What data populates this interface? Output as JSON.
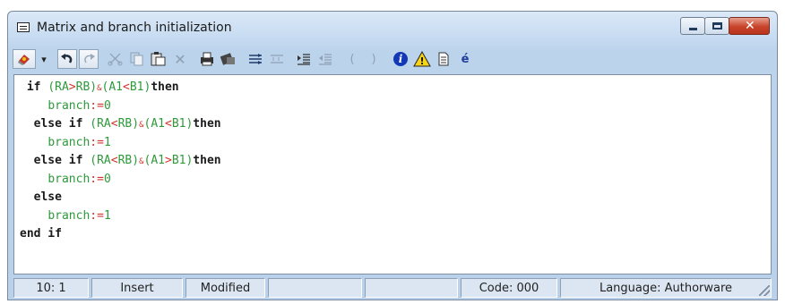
{
  "window": {
    "title": "Matrix and branch initialization",
    "controls": {
      "minimize_icon": "minimize-icon",
      "maximize_icon": "maximize-icon",
      "close_glyph": "✕"
    }
  },
  "toolbar": {
    "buttons": [
      {
        "icon": "eraser-icon",
        "label": ""
      },
      {
        "icon": "dropdown-arrow-icon",
        "label": "▾"
      },
      {
        "icon": "undo-icon",
        "label": ""
      },
      {
        "icon": "redo-icon",
        "label": ""
      },
      {
        "icon": "cut-icon",
        "label": ""
      },
      {
        "icon": "copy-icon",
        "label": ""
      },
      {
        "icon": "paste-icon",
        "label": ""
      },
      {
        "icon": "delete-icon",
        "label": "✕"
      },
      {
        "icon": "print-icon",
        "label": ""
      },
      {
        "icon": "find-icon",
        "label": ""
      },
      {
        "icon": "indent-icon",
        "label": ""
      },
      {
        "icon": "outdent-icon",
        "label": ""
      },
      {
        "icon": "block-indent-icon",
        "label": ""
      },
      {
        "icon": "block-outdent-icon",
        "label": ""
      },
      {
        "icon": "open-paren-icon",
        "label": "("
      },
      {
        "icon": "close-paren-icon",
        "label": ")"
      },
      {
        "icon": "info-icon",
        "label": "i"
      },
      {
        "icon": "warning-icon",
        "label": "!"
      },
      {
        "icon": "document-icon",
        "label": ""
      },
      {
        "icon": "accent-char-icon",
        "label": "é"
      }
    ]
  },
  "code_lines": [
    {
      "indent": " ",
      "tokens": [
        {
          "t": "kw",
          "v": "if"
        },
        {
          "t": "p",
          "v": " "
        },
        {
          "t": "g",
          "v": "(RA"
        },
        {
          "t": "r",
          "v": ">"
        },
        {
          "t": "g",
          "v": "RB)"
        },
        {
          "t": "r",
          "v": "&"
        },
        {
          "t": "g",
          "v": "(A1"
        },
        {
          "t": "r",
          "v": "<"
        },
        {
          "t": "g",
          "v": "B1)"
        },
        {
          "t": "kw",
          "v": "then"
        }
      ]
    },
    {
      "indent": "    ",
      "tokens": [
        {
          "t": "g",
          "v": "branch"
        },
        {
          "t": "r",
          "v": ":="
        },
        {
          "t": "g",
          "v": "0"
        }
      ]
    },
    {
      "indent": "  ",
      "tokens": [
        {
          "t": "kw",
          "v": "else if"
        },
        {
          "t": "p",
          "v": " "
        },
        {
          "t": "g",
          "v": "(RA"
        },
        {
          "t": "r",
          "v": "<"
        },
        {
          "t": "g",
          "v": "RB)"
        },
        {
          "t": "r",
          "v": "&"
        },
        {
          "t": "g",
          "v": "(A1"
        },
        {
          "t": "r",
          "v": "<"
        },
        {
          "t": "g",
          "v": "B1)"
        },
        {
          "t": "kw",
          "v": "then"
        }
      ]
    },
    {
      "indent": "    ",
      "tokens": [
        {
          "t": "g",
          "v": "branch"
        },
        {
          "t": "r",
          "v": ":="
        },
        {
          "t": "g",
          "v": "1"
        }
      ]
    },
    {
      "indent": "  ",
      "tokens": [
        {
          "t": "kw",
          "v": "else if"
        },
        {
          "t": "p",
          "v": " "
        },
        {
          "t": "g",
          "v": "(RA"
        },
        {
          "t": "r",
          "v": "<"
        },
        {
          "t": "g",
          "v": "RB)"
        },
        {
          "t": "r",
          "v": "&"
        },
        {
          "t": "g",
          "v": "(A1"
        },
        {
          "t": "r",
          "v": ">"
        },
        {
          "t": "g",
          "v": "B1)"
        },
        {
          "t": "kw",
          "v": "then"
        }
      ]
    },
    {
      "indent": "    ",
      "tokens": [
        {
          "t": "g",
          "v": "branch"
        },
        {
          "t": "r",
          "v": ":="
        },
        {
          "t": "g",
          "v": "0"
        }
      ]
    },
    {
      "indent": "  ",
      "tokens": [
        {
          "t": "kw",
          "v": "else"
        }
      ]
    },
    {
      "indent": "    ",
      "tokens": [
        {
          "t": "g",
          "v": "branch"
        },
        {
          "t": "r",
          "v": ":="
        },
        {
          "t": "g",
          "v": "1"
        }
      ]
    },
    {
      "indent": "",
      "tokens": [
        {
          "t": "kw",
          "v": "end if"
        }
      ]
    }
  ],
  "status": {
    "position": "10: 1",
    "mode": "Insert",
    "state": "Modified",
    "blank1": "",
    "blank2": "",
    "code": "Code: 000",
    "language": "Language: Authorware"
  },
  "colors": {
    "keyword": "#1a1a1a",
    "identifier": "#2e9a3b",
    "operator": "#d0342c"
  }
}
